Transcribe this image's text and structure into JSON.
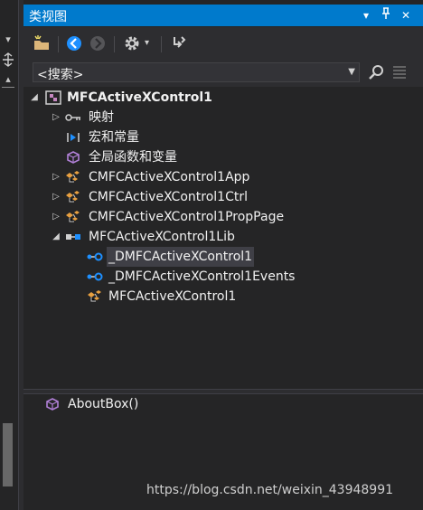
{
  "window": {
    "title": "类视图"
  },
  "titlebar_buttons": [
    "chevron-down-icon",
    "pin-icon",
    "close-icon"
  ],
  "toolbar": {
    "buttons": [
      "new-folder-icon",
      "back-icon",
      "forward-icon",
      "settings-icon",
      "sync-icon"
    ]
  },
  "search": {
    "placeholder": "<搜索>"
  },
  "tree": {
    "nodes": [
      {
        "label": "MFCActiveXControl1",
        "level": 0,
        "expanded": true,
        "bold": true,
        "icon": "project-icon"
      },
      {
        "label": "映射",
        "level": 1,
        "expanded": false,
        "icon": "key-icon"
      },
      {
        "label": "宏和常量",
        "level": 1,
        "icon": "macro-icon"
      },
      {
        "label": "全局函数和变量",
        "level": 1,
        "icon": "cube-icon"
      },
      {
        "label": "CMFCActiveXControl1App",
        "level": 1,
        "expanded": false,
        "icon": "class-icon"
      },
      {
        "label": "CMFCActiveXControl1Ctrl",
        "level": 1,
        "expanded": false,
        "icon": "class-icon"
      },
      {
        "label": "CMFCActiveXControl1PropPage",
        "level": 1,
        "expanded": false,
        "icon": "class-icon"
      },
      {
        "label": "MFCActiveXControl1Lib",
        "level": 1,
        "expanded": true,
        "icon": "library-icon"
      },
      {
        "label": "_DMFCActiveXControl1",
        "level": 2,
        "selected": true,
        "icon": "interface-icon"
      },
      {
        "label": "_DMFCActiveXControl1Events",
        "level": 2,
        "icon": "interface-icon"
      },
      {
        "label": "MFCActiveXControl1",
        "level": 2,
        "icon": "class-icon"
      }
    ]
  },
  "members": [
    {
      "label": "AboutBox()",
      "icon": "method-icon"
    }
  ],
  "watermark": "https://blog.csdn.net/weixin_43948991",
  "colors": {
    "accent": "#007acc",
    "background": "#252526",
    "toolbar": "#2d2d30",
    "text": "#f1f1f1",
    "selection": "#3f3f46"
  }
}
